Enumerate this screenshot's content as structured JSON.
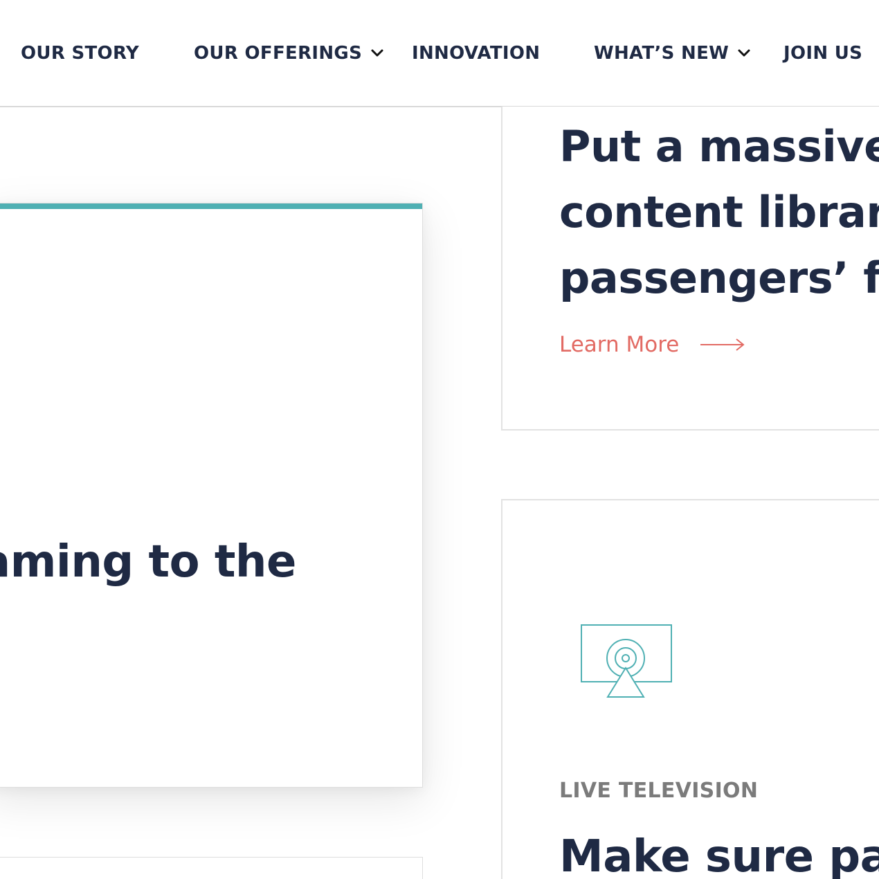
{
  "nav": {
    "items": [
      {
        "label": "OUR STORY",
        "has_dropdown": false
      },
      {
        "label": "OUR OFFERINGS",
        "has_dropdown": true
      },
      {
        "label": "INNOVATION",
        "has_dropdown": false
      },
      {
        "label": "WHAT’S NEW",
        "has_dropdown": true
      },
      {
        "label": "JOIN US",
        "has_dropdown": false
      }
    ]
  },
  "featured_card": {
    "title_fragment": "aming to the",
    "accent_color": "#4fb0b3"
  },
  "content_card": {
    "title": "Put a massive a\ncontent library\npassengers’ fing",
    "cta_label": "Learn More",
    "cta_color": "#e26a63"
  },
  "live_tv_card": {
    "icon": "broadcast-screen-icon",
    "eyebrow": "LIVE TELEVISION",
    "title": "Make sure pass"
  },
  "colors": {
    "heading": "#1f2a44",
    "accent_teal": "#4fb0b3",
    "link_coral": "#e26a63",
    "eyebrow_gray": "#7b7b7b"
  }
}
